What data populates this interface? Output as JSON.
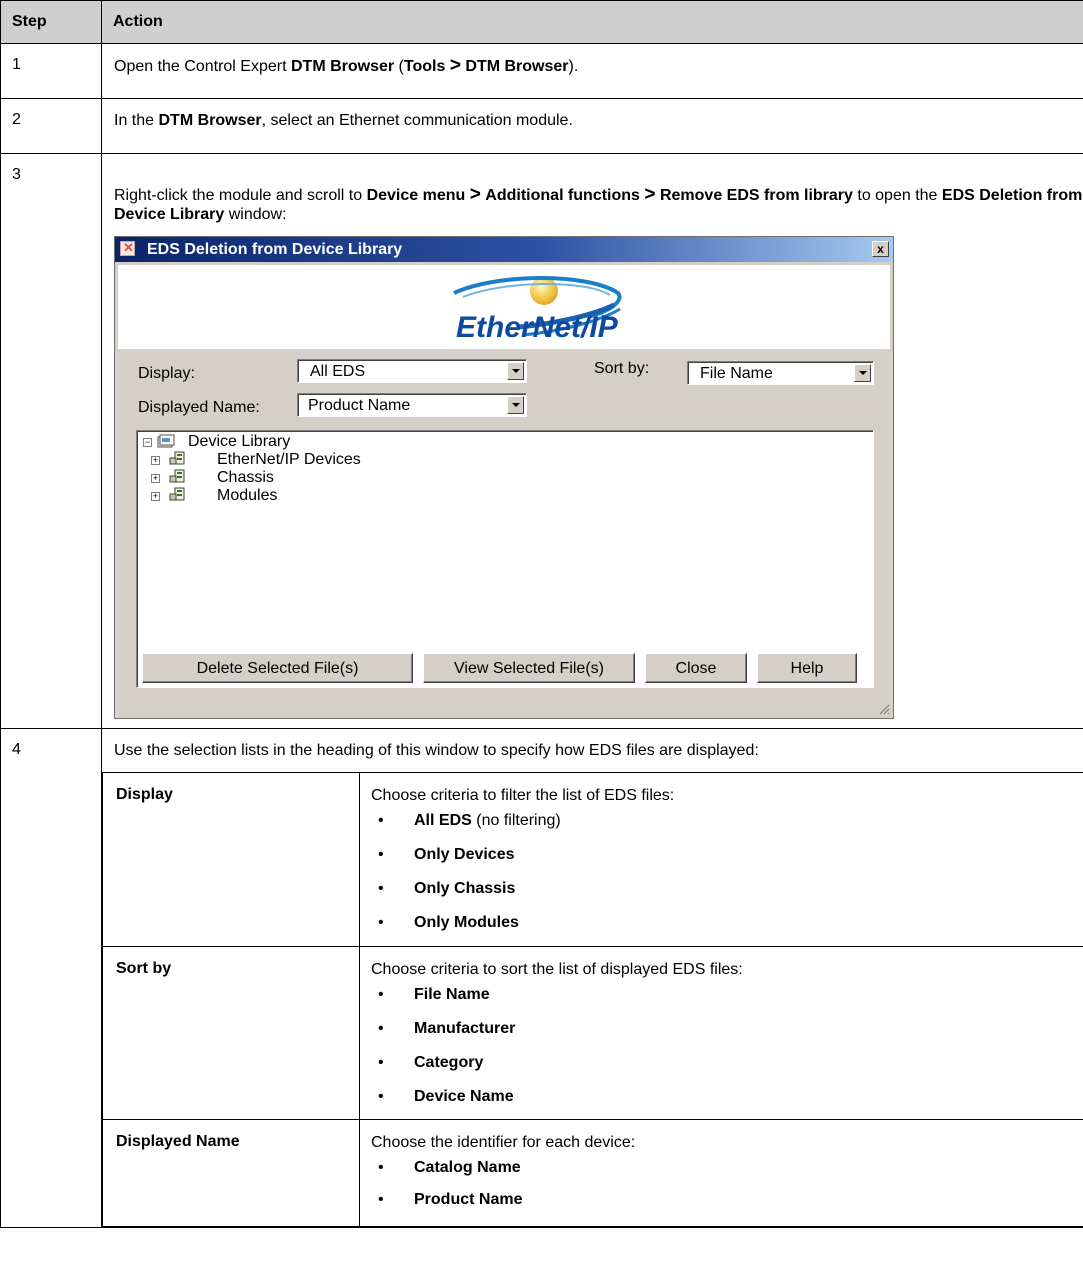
{
  "table": {
    "header": {
      "step": "Step",
      "action": "Action"
    }
  },
  "steps": [
    {
      "num": "1",
      "parts": {
        "a": "Open the Control Expert ",
        "b": "DTM Browser",
        "c": " (",
        "d": "Tools",
        "e": ">",
        "f": "DTM Browser",
        "g": ")."
      }
    },
    {
      "num": "2",
      "parts": {
        "a": "In the ",
        "b": "DTM Browser",
        "c": ", select an Ethernet communication module."
      }
    },
    {
      "num": "3",
      "parts": {
        "a": "Right-click the module and scroll to ",
        "b": "Device menu",
        "c": ">",
        "d": "Additional functions",
        "e": ">",
        "f": "Remove EDS from library",
        "g": " to open the ",
        "h": "EDS Deletion from Device Library",
        "i": " window:"
      }
    },
    {
      "num": "4",
      "text": "Use the selection lists in the heading of this window to specify how EDS files are displayed:"
    }
  ],
  "dialog": {
    "title": "EDS Deletion from Device Library",
    "close_glyph": "x",
    "logo_text": "EtherNet/IP",
    "logo_tm": "™",
    "display_label": "Display:",
    "display_value": "All EDS",
    "sort_label": "Sort by:",
    "sort_value": "File Name",
    "displayed_name_label": "Displayed Name:",
    "displayed_name_value": "Product Name",
    "tree": {
      "root": "Device Library",
      "children": [
        "EtherNet/IP Devices",
        "Chassis",
        "Modules"
      ]
    },
    "buttons": {
      "delete": "Delete Selected File(s)",
      "view": "View Selected File(s)",
      "close": "Close",
      "help": "Help"
    }
  },
  "options": [
    {
      "name": "Display",
      "desc": "Choose criteria to filter the list of EDS files:",
      "items": [
        {
          "label": "All EDS",
          "note": " (no filtering)"
        },
        {
          "label": "Only Devices",
          "note": ""
        },
        {
          "label": "Only Chassis",
          "note": ""
        },
        {
          "label": "Only Modules",
          "note": ""
        }
      ]
    },
    {
      "name": "Sort by",
      "desc": "Choose criteria to sort the list of displayed EDS files:",
      "items": [
        {
          "label": "File Name",
          "note": ""
        },
        {
          "label": "Manufacturer",
          "note": ""
        },
        {
          "label": "Category",
          "note": ""
        },
        {
          "label": "Device Name",
          "note": ""
        }
      ]
    },
    {
      "name": "Displayed Name",
      "desc": "Choose the identifier for each device:",
      "items": [
        {
          "label": "Catalog Name",
          "note": ""
        },
        {
          "label": "Product Name",
          "note": ""
        }
      ]
    }
  ],
  "bullet_glyph": "•"
}
